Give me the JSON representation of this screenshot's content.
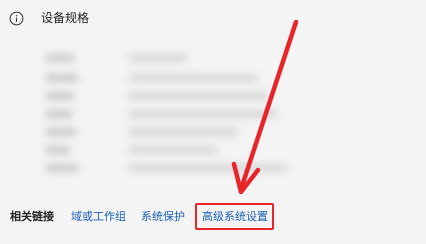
{
  "header": {
    "icon": "info-icon",
    "title": "设备规格"
  },
  "footer": {
    "related_label": "相关链接",
    "links": [
      {
        "label": "域或工作组"
      },
      {
        "label": "系统保护"
      },
      {
        "label": "高级系统设置"
      }
    ]
  },
  "annotation": {
    "color": "#e8262a",
    "target": "高级系统设置"
  }
}
